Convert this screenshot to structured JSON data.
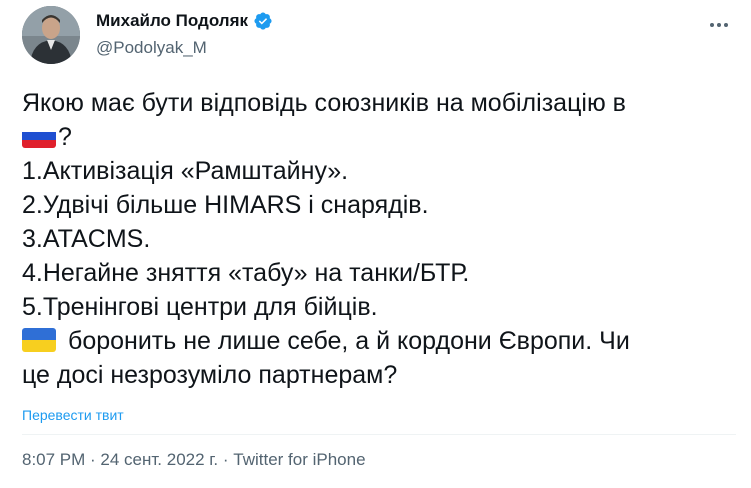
{
  "author": {
    "name": "Михайло Подоляк",
    "handle": "@Podolyak_M"
  },
  "tweet": {
    "line1": "Якою має бути відповідь союзників на мобілізацію в",
    "line2_suffix": "?",
    "item1": "1.Активізація «Рамштайну».",
    "item2": "2.Удвічі більше HIMARS і снарядів.",
    "item3": "3.ATACMS.",
    "item4": "4.Негайне зняття «табу» на танки/БТР.",
    "item5": "5.Тренінгові центри для бійців.",
    "line_ua": "боронить не лише себе, а й кордони Європи. Чи",
    "line_last": "це досі незрозуміло партнерам?",
    "flags": [
      "russia-flag",
      "ukraine-flag"
    ]
  },
  "translate_label": "Перевести твит",
  "meta": {
    "time": "8:07 PM",
    "sep1": " · ",
    "date": "24 сент. 2022 г.",
    "sep2": " · ",
    "source": "Twitter for iPhone"
  },
  "colors": {
    "accent": "#1d9bf0",
    "secondary_text": "#536471"
  }
}
